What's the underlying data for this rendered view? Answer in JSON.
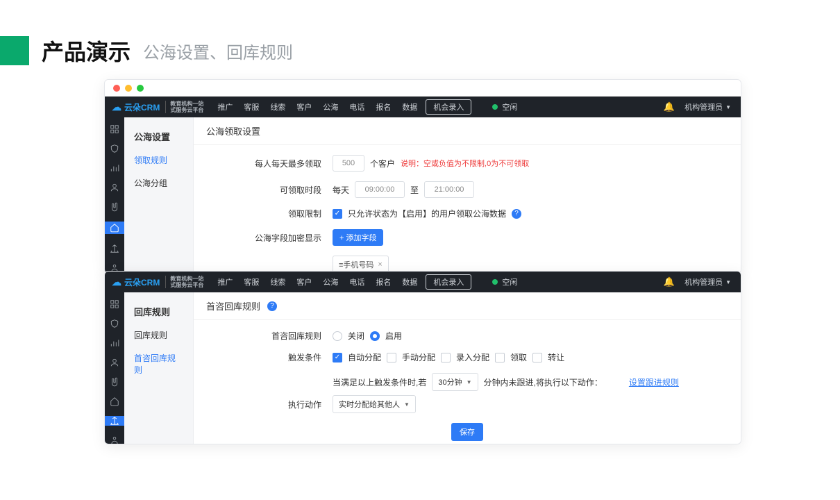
{
  "slide": {
    "title": "产品演示",
    "sub": "公海设置、回库规则"
  },
  "logo": {
    "brand": "云朵CRM",
    "sub1": "教育机构一站",
    "sub2": "式服务云平台"
  },
  "nav": [
    "推广",
    "客服",
    "线索",
    "客户",
    "公海",
    "电话",
    "报名",
    "数据"
  ],
  "nav_btn": "机会录入",
  "idle": "空闲",
  "user": "机构管理员",
  "winA": {
    "side_head": "公海设置",
    "side": [
      "领取规则",
      "公海分组"
    ],
    "section": "公海领取设置",
    "row1_lbl": "每人每天最多领取",
    "row1_val": "500",
    "row1_unit": "个客户",
    "row1_note": "说明：空或负值为不限制,0为不可领取",
    "row2_lbl": "可领取时段",
    "row2_pre": "每天",
    "row2_from": "09:00:00",
    "row2_to_lbl": "至",
    "row2_to": "21:00:00",
    "row3_lbl": "领取限制",
    "row3_text": "只允许状态为【启用】的用户领取公海数据",
    "row4_lbl": "公海字段加密显示",
    "row4_btn": "+ 添加字段",
    "row4_tag": "≡手机号码"
  },
  "winB": {
    "side_head": "回库规则",
    "side": [
      "回库规则",
      "首咨回库规则"
    ],
    "section": "首咨回库规则",
    "row1_lbl": "首咨回库规则",
    "row1_off": "关闭",
    "row1_on": "启用",
    "row2_lbl": "触发条件",
    "row2_opts": [
      "自动分配",
      "手动分配",
      "录入分配",
      "领取",
      "转让"
    ],
    "row3_lbl": "执行动作",
    "row3_pre": "当满足以上触发条件时,若",
    "row3_sel": "30分钟",
    "row3_post": "分钟内未跟进,将执行以下动作：",
    "row3_link": "设置跟进规则",
    "row3_action": "实时分配给其他人",
    "save": "保存"
  }
}
